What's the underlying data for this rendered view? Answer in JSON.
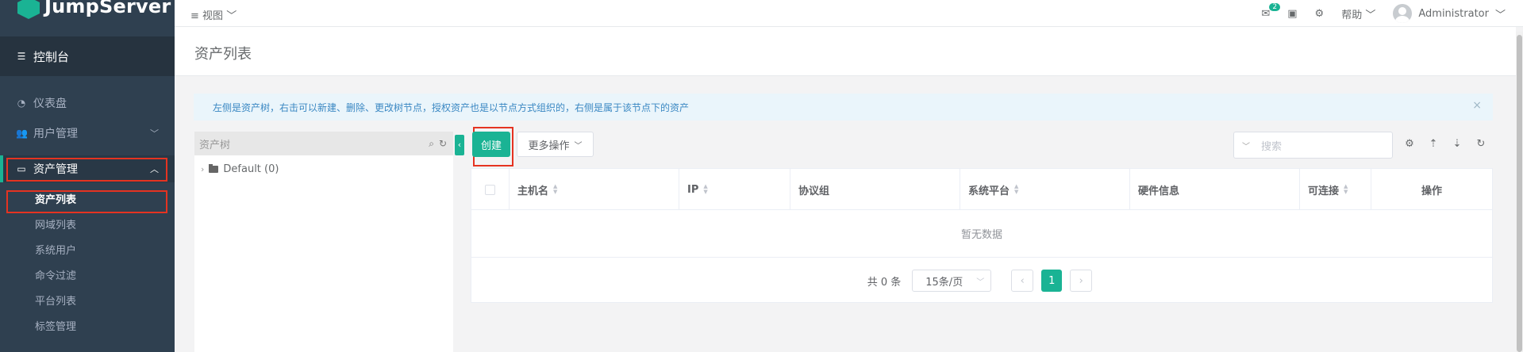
{
  "app": {
    "name": "JumpServer"
  },
  "topbar": {
    "view_label": "视图",
    "help_label": "帮助",
    "user_name": "Administrator",
    "notification_count": "2"
  },
  "sidebar": {
    "console_label": "控制台",
    "items": [
      {
        "label": "仪表盘",
        "icon": "dashboard-icon"
      },
      {
        "label": "用户管理",
        "icon": "users-icon"
      },
      {
        "label": "资产管理",
        "icon": "inbox-icon"
      }
    ],
    "asset_sub_items": [
      "资产列表",
      "网域列表",
      "系统用户",
      "命令过滤",
      "平台列表",
      "标签管理"
    ],
    "active_sub_item": "资产列表"
  },
  "page": {
    "title": "资产列表",
    "alert_text": "左侧是资产树，右击可以新建、删除、更改树节点，授权资产也是以节点方式组织的，右侧是属于该节点下的资产"
  },
  "tree": {
    "header": "资产树",
    "root_node": "Default (0)"
  },
  "toolbar": {
    "create_label": "创建",
    "more_actions_label": "更多操作",
    "search_placeholder": "搜索"
  },
  "table": {
    "columns": [
      "主机名",
      "IP",
      "协议组",
      "系统平台",
      "硬件信息",
      "可连接",
      "操作"
    ],
    "empty_text": "暂无数据"
  },
  "pagination": {
    "total_text": "共 0 条",
    "page_size": "15条/页",
    "current_page": "1"
  },
  "colors": {
    "accent": "#1ab394",
    "sidebar_bg": "#2f4050",
    "highlight_box": "#e53321"
  }
}
